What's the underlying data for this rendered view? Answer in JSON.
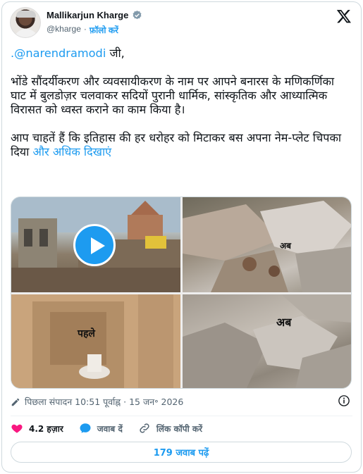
{
  "author": {
    "name": "Mallikarjun Kharge",
    "handle": "@kharge",
    "separator": "·",
    "follow_label": "फ़ॉलो करें"
  },
  "tweet": {
    "mention": ".@narendramodi",
    "line1_suffix": " जी,",
    "para2": "भोंडे सौंदर्यीकरण और व्यवसायीकरण के नाम पर आपने बनारस के मणिकर्णिका घाट में बुलडोज़र चलवाकर सदियों पुरानी धार्मिक, सांस्कृतिक और आध्यात्मिक विरासत को ध्वस्त कराने का काम किया है।",
    "para3": "आप चाहतें हैं कि इतिहास की हर धरोहर को मिटाकर बस अपना नेम-प्लेट चिपका दिया ",
    "show_more": "और अधिक दिखाएं"
  },
  "media": {
    "label_before_small": "अब",
    "label_before": "पहले",
    "label_after": "अब"
  },
  "meta": {
    "edited": "पिछला संपादन 10:51 पूर्वाह्न · 15 जन॰ 2026"
  },
  "actions": {
    "likes": "4.2 हज़ार",
    "reply": "जवाब दें",
    "copy_link": "लिंक कॉपी करें"
  },
  "replies_button": "179 जवाब पढ़ें",
  "colors": {
    "accent": "#1d9bf0",
    "like": "#f91880"
  }
}
